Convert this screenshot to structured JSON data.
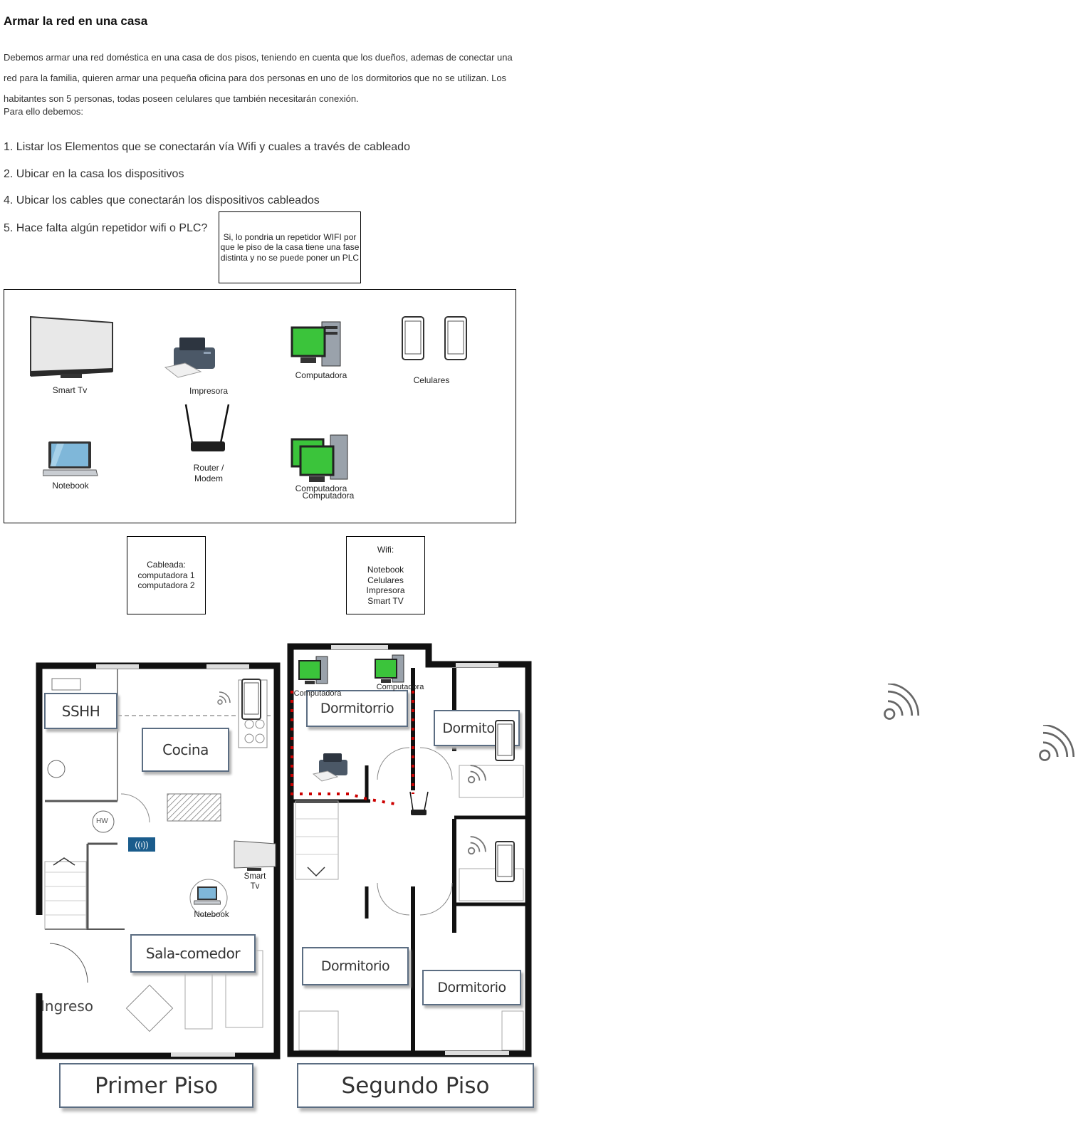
{
  "title": "Armar la red en una casa",
  "intro": {
    "lines": [
      "Debemos armar una red doméstica en una casa de dos pisos, teniendo en cuenta que los dueños, ademas de conectar una",
      "red para la familia, quieren armar una pequeña oficina para dos personas en uno de los dormitorios que no se utilizan. Los",
      "habitantes son 5 personas, todas poseen celulares que también necesitarán conexión."
    ],
    "tail": "Para ello debemos:"
  },
  "tasks": [
    "1. Listar los Elementos que se conectarán vía Wifi y cuales a través de cableado",
    "2. Ubicar en la casa los dispositivos",
    "4. Ubicar los cables que conectarán los dispositivos cableados",
    "5. Hace falta algún repetidor wifi o PLC?"
  ],
  "answer": {
    "lines": [
      "Si, lo pondria un repetidor  WIFI por",
      "que le piso de la casa tiene una fase",
      "distinta y no se puede poner un PLC"
    ]
  },
  "devices": {
    "smart_tv": "Smart Tv",
    "printer": "Impresora",
    "computer": "Computadora",
    "phones": "Celulares",
    "notebook": "Notebook",
    "router": [
      "Router /",
      "Modem"
    ],
    "computer2a": "Computadora",
    "computer2b": "Computadora"
  },
  "wired_box": {
    "lines": [
      "Cableada:",
      "computadora 1",
      "computadora 2"
    ]
  },
  "wifi_box": {
    "heading": "Wifi:",
    "lines": [
      "Notebook",
      "Celulares",
      "Impresora",
      "Smart TV"
    ]
  },
  "plan": {
    "first_floor": {
      "rooms": {
        "sshh": "SSHH",
        "cocina": "Cocina",
        "sala": "Sala-comedor",
        "ingreso": "Ingreso",
        "hw": "HW"
      },
      "labels": {
        "smart_tv": [
          "Smart",
          "Tv"
        ],
        "notebook": "Notebook"
      },
      "title": "Primer Piso"
    },
    "second_floor": {
      "rooms": {
        "dorm_nw": "Dormitorrio",
        "dorm_ne": "Dormitorio",
        "dorm_sw": "Dormitorio",
        "dorm_se": "Dormitorio"
      },
      "labels": {
        "pc1": "Computadora",
        "pc2": "Computadora"
      },
      "title": "Segundo Piso"
    }
  },
  "colors": {
    "wall": "#111111",
    "cable": "#cc0000",
    "screen_green": "#3bc43b",
    "repeater": "#1a5c8c"
  }
}
